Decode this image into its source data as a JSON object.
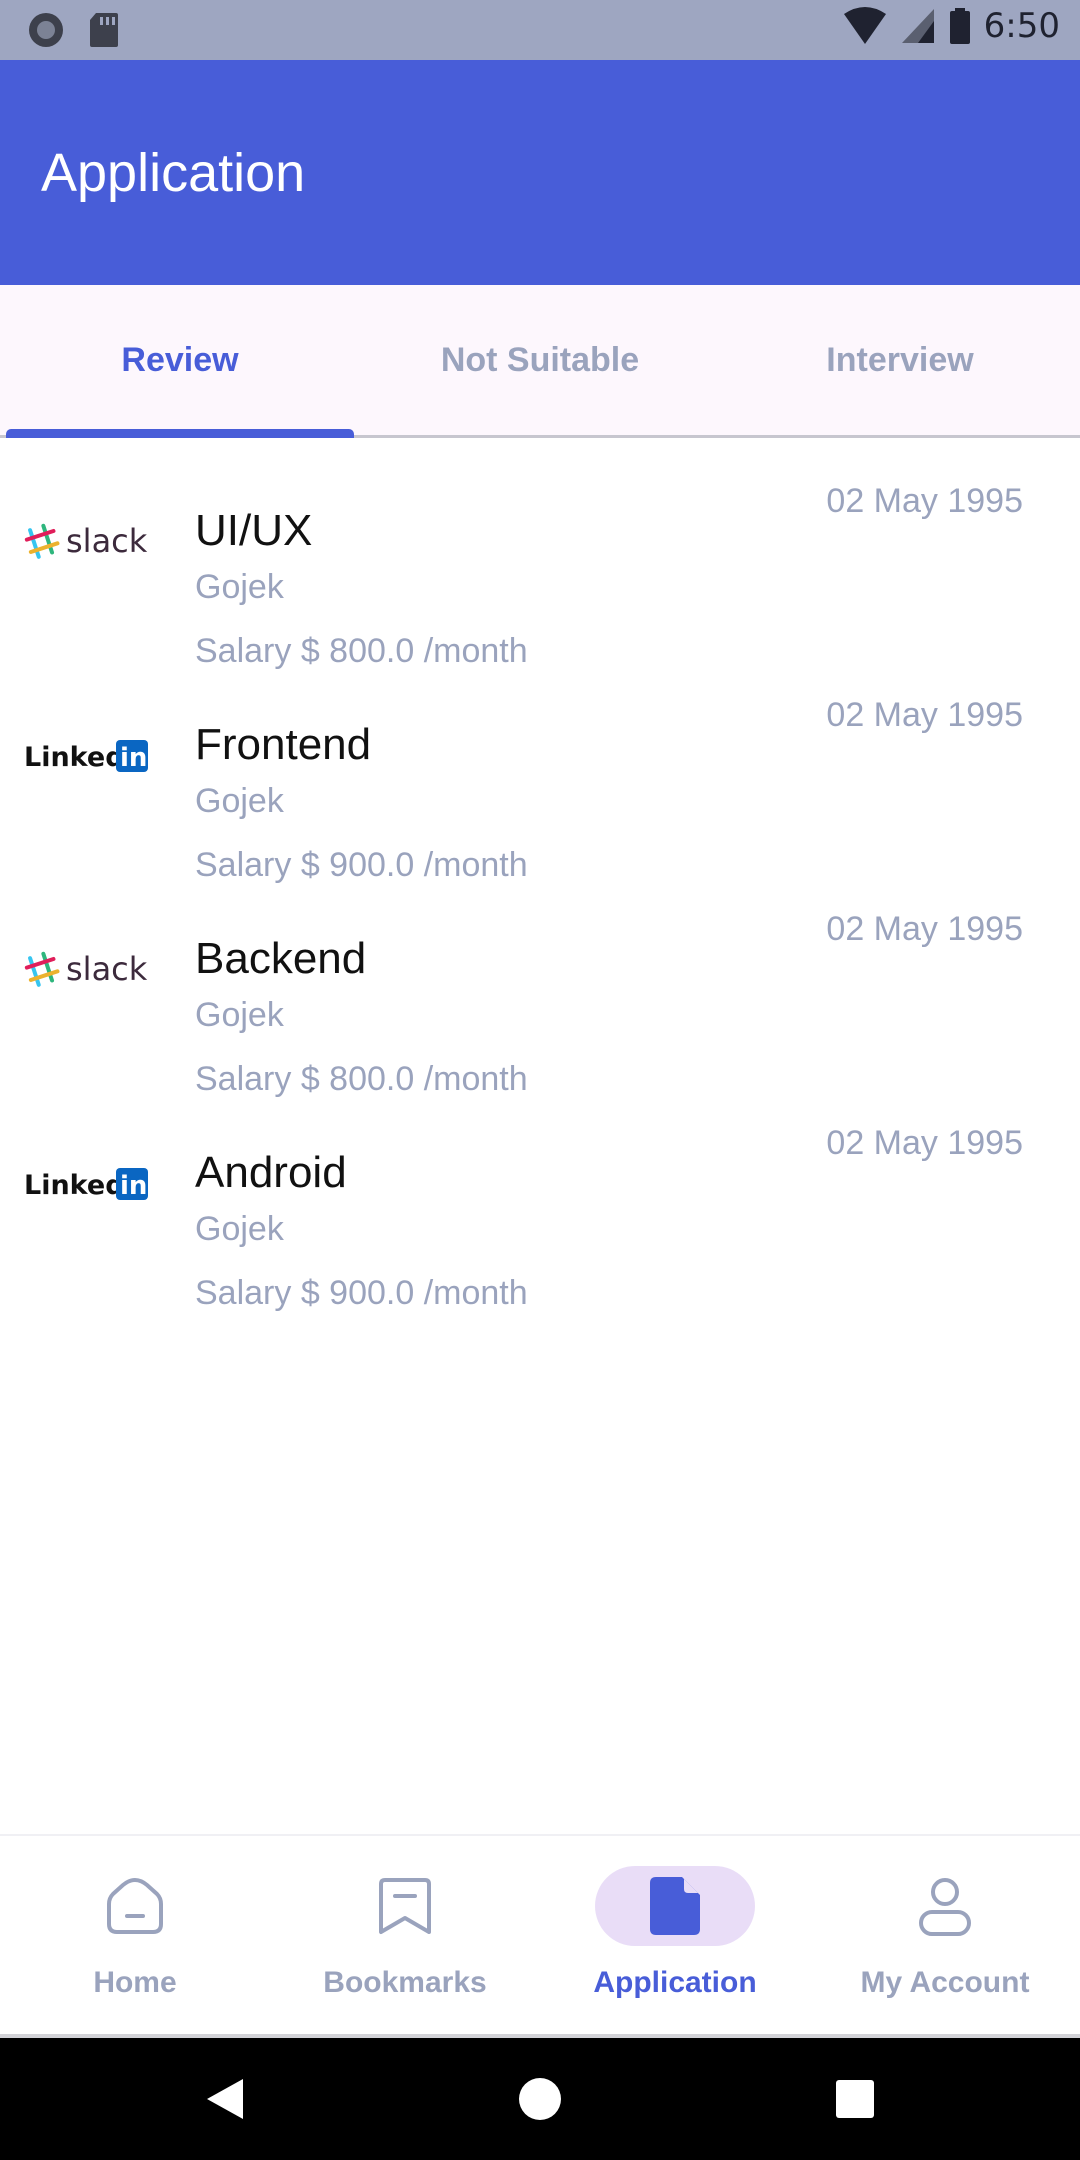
{
  "status_bar": {
    "time": "6:50"
  },
  "app_bar": {
    "title": "Application"
  },
  "tabs": [
    {
      "label": "Review",
      "active": true
    },
    {
      "label": "Not Suitable",
      "active": false
    },
    {
      "label": "Interview",
      "active": false
    }
  ],
  "jobs": [
    {
      "logo": "slack",
      "logo_text": "slack",
      "title": "UI/UX",
      "company": "Gojek",
      "salary": "Salary $ 800.0 /month",
      "date": "02 May 1995"
    },
    {
      "logo": "linkedin",
      "logo_text": "Linked",
      "title": "Frontend",
      "company": "Gojek",
      "salary": "Salary $ 900.0 /month",
      "date": "02 May 1995"
    },
    {
      "logo": "slack",
      "logo_text": "slack",
      "title": "Backend",
      "company": "Gojek",
      "salary": "Salary $ 800.0 /month",
      "date": "02 May 1995"
    },
    {
      "logo": "linkedin",
      "logo_text": "Linked",
      "title": "Android",
      "company": "Gojek",
      "salary": "Salary $ 900.0 /month",
      "date": "02 May 1995"
    }
  ],
  "bottom_nav": [
    {
      "label": "Home",
      "icon": "home-icon",
      "active": false
    },
    {
      "label": "Bookmarks",
      "icon": "bookmark-icon",
      "active": false
    },
    {
      "label": "Application",
      "icon": "document-icon",
      "active": true
    },
    {
      "label": "My Account",
      "icon": "account-icon",
      "active": false
    }
  ],
  "colors": {
    "primary": "#485dd8",
    "muted": "#9aa3bd",
    "tab_bg": "#fdf7fd",
    "active_pill": "#e9ddf7"
  }
}
